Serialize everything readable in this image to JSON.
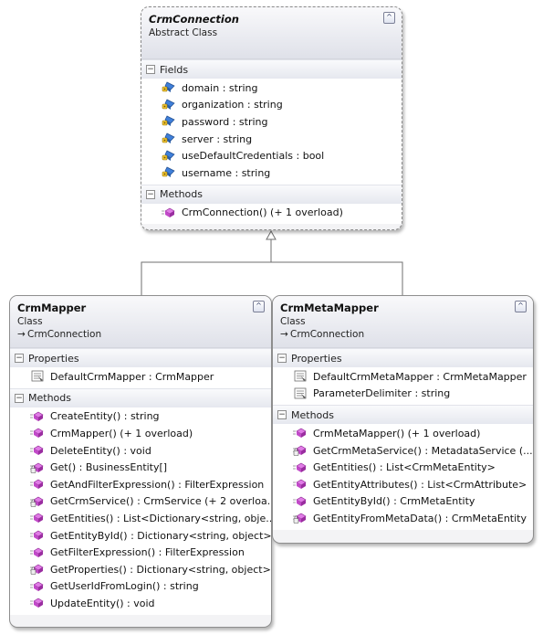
{
  "classes": {
    "crm_connection": {
      "name": "CrmConnection",
      "kind": "Abstract Class",
      "fields_label": "Fields",
      "fields": [
        {
          "text": "domain : string",
          "icon": "protected-field-icon"
        },
        {
          "text": "organization : string",
          "icon": "protected-field-icon"
        },
        {
          "text": "password : string",
          "icon": "protected-field-icon"
        },
        {
          "text": "server : string",
          "icon": "protected-field-icon"
        },
        {
          "text": "useDefaultCredentials : bool",
          "icon": "protected-field-icon"
        },
        {
          "text": "username : string",
          "icon": "protected-field-icon"
        }
      ],
      "methods_label": "Methods",
      "methods": [
        {
          "text": "CrmConnection() (+ 1 overload)",
          "icon": "public-method-icon"
        }
      ]
    },
    "crm_mapper": {
      "name": "CrmMapper",
      "kind": "Class",
      "inherits": "CrmConnection",
      "properties_label": "Properties",
      "properties": [
        {
          "text": "DefaultCrmMapper : CrmMapper",
          "icon": "property-icon"
        }
      ],
      "methods_label": "Methods",
      "methods": [
        {
          "text": "CreateEntity() : string",
          "icon": "public-method-icon"
        },
        {
          "text": "CrmMapper() (+ 1 overload)",
          "icon": "public-method-icon"
        },
        {
          "text": "DeleteEntity() : void",
          "icon": "public-method-icon"
        },
        {
          "text": "Get() : BusinessEntity[]",
          "icon": "private-method-icon"
        },
        {
          "text": "GetAndFilterExpression() : FilterExpression",
          "icon": "public-method-icon"
        },
        {
          "text": "GetCrmService() : CrmService (+ 2 overloa...",
          "icon": "private-method-icon"
        },
        {
          "text": "GetEntities() : List<Dictionary<string, obje...",
          "icon": "public-method-icon"
        },
        {
          "text": "GetEntityById() : Dictionary<string, object>",
          "icon": "public-method-icon"
        },
        {
          "text": "GetFilterExpression() : FilterExpression",
          "icon": "public-method-icon"
        },
        {
          "text": "GetProperties() : Dictionary<string, object>",
          "icon": "private-method-icon"
        },
        {
          "text": "GetUserIdFromLogin() : string",
          "icon": "public-method-icon"
        },
        {
          "text": "UpdateEntity() : void",
          "icon": "public-method-icon"
        }
      ]
    },
    "crm_meta_mapper": {
      "name": "CrmMetaMapper",
      "kind": "Class",
      "inherits": "CrmConnection",
      "properties_label": "Properties",
      "properties": [
        {
          "text": "DefaultCrmMetaMapper : CrmMetaMapper",
          "icon": "property-icon"
        },
        {
          "text": "ParameterDelimiter : string",
          "icon": "property-icon"
        }
      ],
      "methods_label": "Methods",
      "methods": [
        {
          "text": "CrmMetaMapper() (+ 1 overload)",
          "icon": "public-method-icon"
        },
        {
          "text": "GetCrmMetaService() : MetadataService (...",
          "icon": "private-method-icon"
        },
        {
          "text": "GetEntities() : List<CrmMetaEntity>",
          "icon": "public-method-icon"
        },
        {
          "text": "GetEntityAttributes() : List<CrmAttribute>",
          "icon": "public-method-icon"
        },
        {
          "text": "GetEntityById() : CrmMetaEntity",
          "icon": "public-method-icon"
        },
        {
          "text": "GetEntityFromMetaData() : CrmMetaEntity",
          "icon": "private-method-icon"
        }
      ]
    }
  },
  "colors": {
    "method": "#c24ac9",
    "field": "#3f7fd9",
    "header_bottom": "#dfe1e9"
  }
}
